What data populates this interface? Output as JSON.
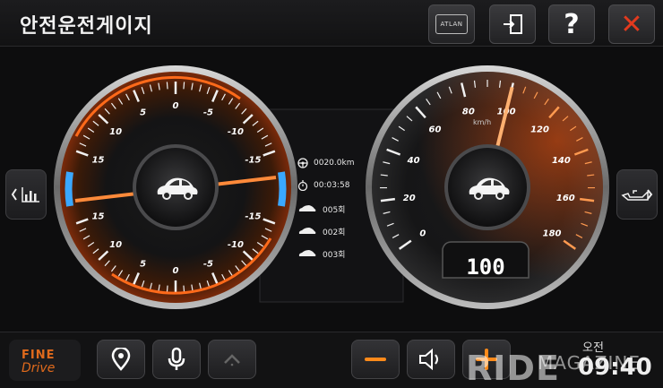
{
  "header": {
    "title": "안전운전게이지",
    "atlan_label": "ATLAN"
  },
  "left_gauge": {
    "tick_labels_top": [
      "15",
      "10",
      "5",
      "0",
      "-5",
      "-10",
      "-15"
    ],
    "tick_labels_bottom": [
      "15",
      "10",
      "5",
      "0",
      "-5",
      "-10",
      "-15"
    ],
    "needle_value": 0
  },
  "right_gauge": {
    "unit": "km/h",
    "tick_labels": [
      "0",
      "20",
      "40",
      "60",
      "80",
      "100",
      "120",
      "140",
      "160",
      "180"
    ],
    "speed_display": "100",
    "needle_value": 100
  },
  "info_panel": {
    "distance": "0020.0km",
    "time": "00:03:58",
    "count_1": "005회",
    "count_2": "002회",
    "count_3": "003회"
  },
  "bottom": {
    "logo_top": "FINE",
    "logo_bottom": "Drive",
    "clock_ampm": "오전",
    "clock_time": "09:40",
    "watermark_left": "RIDE",
    "watermark_right": "MAGAZINE"
  },
  "colors": {
    "accent_orange": "#ff6a1a",
    "accent_blue": "#3aa8ff",
    "close_red": "#e23a1e"
  }
}
